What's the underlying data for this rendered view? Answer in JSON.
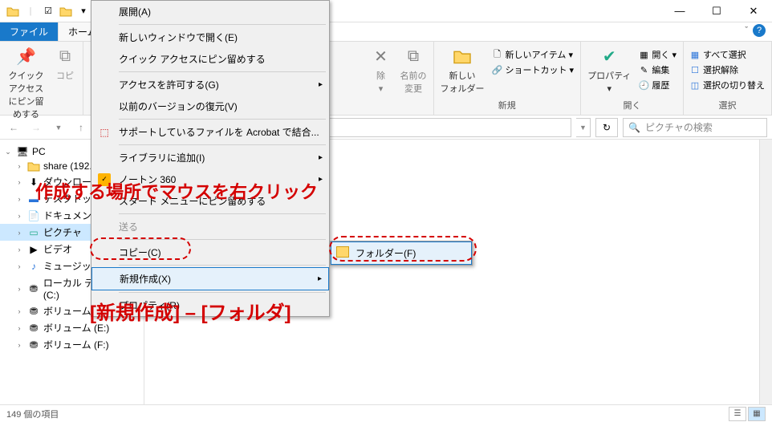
{
  "titlebar": {
    "dropdown": "▾"
  },
  "tabs": {
    "file": "ファイル",
    "home": "ホーム"
  },
  "ribbon": {
    "quick_access": "クイック アクセス\nにピン留めする",
    "copy": "コピ",
    "delete": "除",
    "rename": "名前の\n変更",
    "new_folder": "新しい\nフォルダー",
    "new_item": "新しいアイテム ▾",
    "shortcut": "ショートカット ▾",
    "new_group": "新規",
    "properties": "プロパティ",
    "open": "開く ▾",
    "edit": "編集",
    "history": "履歴",
    "open_group": "開く",
    "select_all": "すべて選択",
    "select_none": "選択解除",
    "select_invert": "選択の切り替え",
    "select_group": "選択"
  },
  "addr": {
    "search_placeholder": "ピクチャの検索"
  },
  "tree": {
    "pc": "PC",
    "share": "share (192.",
    "downloads": "ダウンロード",
    "desktop": "デスクトップ",
    "documents": "ドキュメント",
    "pictures": "ピクチャ",
    "videos": "ビデオ",
    "music": "ミュージック",
    "disk_c": "ローカル ディスク (C:)",
    "vol_d": "ボリューム (D:)",
    "vol_e": "ボリューム (E:)",
    "vol_f": "ボリューム (F:)"
  },
  "context_menu": {
    "expand": "展開(A)",
    "open_new_window": "新しいウィンドウで開く(E)",
    "pin_quick_access": "クイック アクセスにピン留めする",
    "grant_access": "アクセスを許可する(G)",
    "restore_versions": "以前のバージョンの復元(V)",
    "combine_acrobat": "サポートしているファイルを Acrobat で結合...",
    "add_library": "ライブラリに追加(I)",
    "norton": "ノートン 360",
    "pin_start": "スタート メニューにピン留めする",
    "send_to": "送る",
    "copy": "コピー(C)",
    "new": "新規作成(X)",
    "properties": "プロパティ(R)"
  },
  "submenu": {
    "folder": "フォルダー(F)"
  },
  "status": {
    "items": "149 個の項目"
  },
  "annotations": {
    "line1": "作成する場所でマウスを右クリック",
    "line2": "[新規作成] – [フォルダ]"
  }
}
